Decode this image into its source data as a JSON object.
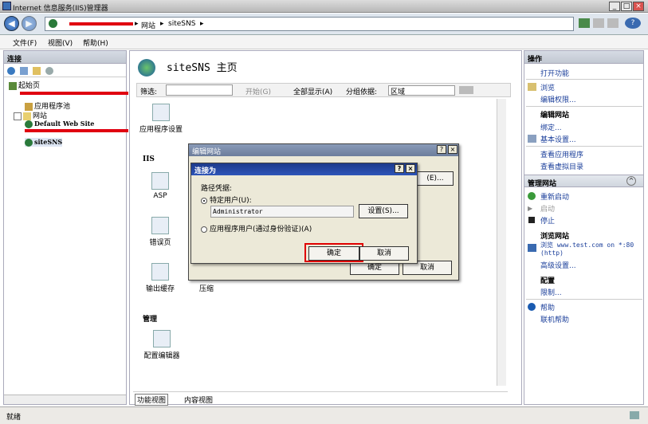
{
  "window": {
    "title": "Internet 信息服务(IIS)管理器",
    "min": "_",
    "max": "□",
    "close": "×"
  },
  "address": {
    "path": [
      "网站",
      "siteSNS"
    ],
    "sep": "▸"
  },
  "menu": [
    "文件(F)",
    "视图(V)",
    "帮助(H)"
  ],
  "left": {
    "header": "连接",
    "tree": [
      {
        "label": "起始页"
      },
      {
        "label": "应用程序池"
      },
      {
        "label": "网站"
      },
      {
        "label": "Default Web Site"
      },
      {
        "label": "siteSNS"
      }
    ]
  },
  "center": {
    "title": "siteSNS 主页",
    "filter": {
      "label": "筛选:",
      "start": "开始(G)",
      "show_all": "全部显示(A)",
      "group_label": "分组依据:",
      "group_value": "区域"
    },
    "features": [
      {
        "label": "应用程序设置"
      },
      {
        "label": "ASP"
      },
      {
        "label": "错误页"
      },
      {
        "label": "输出缓存"
      },
      {
        "label": "压缩"
      },
      {
        "label": "配置编辑器"
      }
    ],
    "sections": {
      "iis": "IIS",
      "manage": "管理"
    },
    "tabs": {
      "features": "功能视图",
      "content": "内容视图"
    }
  },
  "dialog_edit": {
    "title": "编辑网站",
    "help": "?",
    "close": "×",
    "btn_path": "(E)...",
    "ok": "确定",
    "cancel": "取消"
  },
  "dialog_connect": {
    "title": "连接为",
    "help": "?",
    "close": "×",
    "group_label": "路径凭据:",
    "opt_specific": "特定用户(U):",
    "user_value": "Administrator",
    "set_button": "设置(S)...",
    "opt_app": "应用程序用户(通过身份验证)(A)",
    "ok": "确定",
    "cancel": "取消",
    "highlight_color": "#e00000"
  },
  "right": {
    "header": "操作",
    "items": [
      {
        "label": "打开功能",
        "kind": "link"
      },
      {
        "label": "浏览",
        "kind": "link"
      },
      {
        "label": "编辑权限...",
        "kind": "link"
      },
      {
        "label": "编辑网站",
        "kind": "head"
      },
      {
        "label": "绑定...",
        "kind": "link"
      },
      {
        "label": "基本设置...",
        "kind": "link"
      },
      {
        "label": "查看应用程序",
        "kind": "link"
      },
      {
        "label": "查看虚拟目录",
        "kind": "link"
      },
      {
        "label": "管理网站",
        "kind": "section"
      },
      {
        "label": "重新启动",
        "kind": "link"
      },
      {
        "label": "启动",
        "kind": "disabled"
      },
      {
        "label": "停止",
        "kind": "link"
      },
      {
        "label": "浏览网站",
        "kind": "head"
      },
      {
        "label": "浏览 www.test.com on *:80 (http)",
        "kind": "link"
      },
      {
        "label": "高级设置...",
        "kind": "link"
      },
      {
        "label": "配置",
        "kind": "head"
      },
      {
        "label": "限制...",
        "kind": "link"
      },
      {
        "label": "帮助",
        "kind": "link"
      },
      {
        "label": "联机帮助",
        "kind": "link"
      }
    ]
  },
  "status": {
    "text": "就绪"
  }
}
